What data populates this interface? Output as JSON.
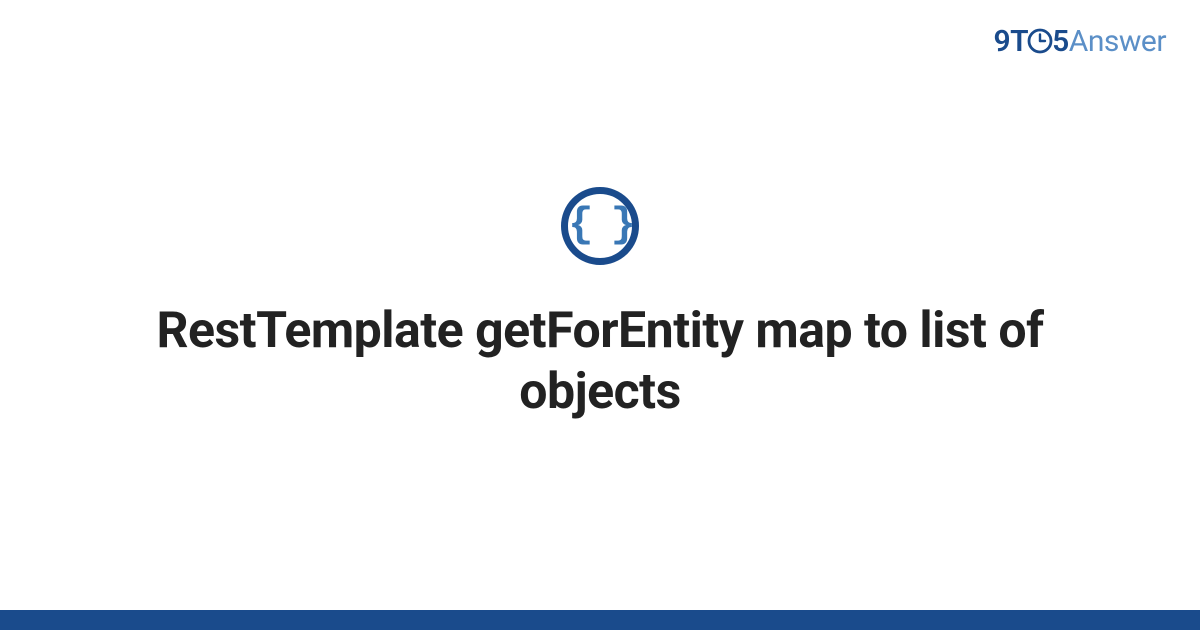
{
  "brand": {
    "part1": "9T",
    "part2": "5",
    "part3": "Answer"
  },
  "icon": {
    "glyph": "{ }",
    "name": "code-braces-icon"
  },
  "title": "RestTemplate getForEntity map to list of objects",
  "colors": {
    "primary": "#1a4b8c",
    "secondary": "#5b8fc7",
    "iconFill": "#3977b5"
  }
}
